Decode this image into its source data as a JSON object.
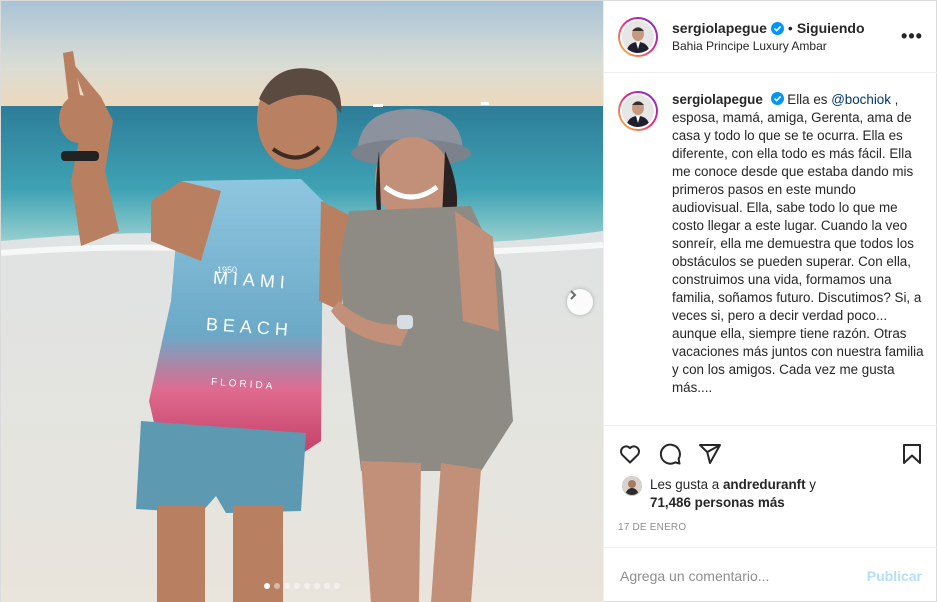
{
  "post": {
    "username": "sergiolapegue",
    "follow_status": "Siguiendo",
    "separator": "•",
    "location": "Bahia Principe Luxury Ambar",
    "more_label": "•••"
  },
  "caption": {
    "username": "sergiolapegue",
    "prefix": "Ella es ",
    "mention": "@bochiok",
    "body": " , esposa, mamá, amiga, Gerenta, ama de casa y todo lo que se te ocurra. Ella es diferente, con ella todo es más fácil. Ella me conoce desde que estaba dando mis primeros pasos en este mundo audiovisual. Ella, sabe todo lo que me costo llegar a este lugar. Cuando la veo sonreír, ella me demuestra que todos los obstáculos se pueden superar. Con ella, construimos una vida, formamos una familia, soñamos futuro. Discutimos? Si, a veces si, pero a decir verdad poco... aunque ella, siempre tiene razón. Otras vacaciones más juntos con nuestra familia y con los amigos. Cada vez me gusta más...."
  },
  "likes": {
    "prefix": "Les gusta a ",
    "liker": "andreduranft",
    "joiner": " y",
    "count": "71,486 personas más"
  },
  "date": "17 DE ENERO",
  "comment_box": {
    "placeholder": "Agrega un comentario...",
    "publish_label": "Publicar"
  },
  "photo_text": {
    "shirt_year": "1950",
    "shirt_line1": "MIAMI",
    "shirt_line2": "BEACH",
    "shirt_line3": "FLORIDA"
  },
  "carousel": {
    "total": 8,
    "active": 0
  },
  "icons": {
    "like": "heart-icon",
    "comment": "comment-icon",
    "share": "send-icon",
    "save": "bookmark-icon",
    "verified": "verified-badge-icon",
    "next": "chevron-right-icon"
  },
  "colors": {
    "verified": "#0095f6",
    "mention": "#00376b",
    "publish_disabled": "#b2dffc",
    "ring_start": "#f9ce34",
    "ring_mid": "#ee2a7b",
    "ring_end": "#6228d7"
  }
}
